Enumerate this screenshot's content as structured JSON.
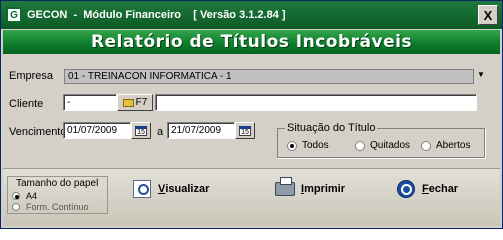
{
  "window": {
    "title": "GECON  -  Módulo Financeiro    [ Versão 3.1.2.84 ]",
    "close_glyph": "X"
  },
  "banner": {
    "title": "Relatório de Títulos Incobráveis"
  },
  "empresa": {
    "label": "Empresa",
    "value": "01 - TREINACON INFORMATICA - 1"
  },
  "cliente": {
    "label": "Cliente",
    "code_value": "-",
    "lookup_label": "F7",
    "name_value": ""
  },
  "vencimento": {
    "label": "Vencimento",
    "from": "01/07/2009",
    "separator": "a",
    "to": "21/07/2009",
    "calendar_glyph": "15"
  },
  "situacao": {
    "title": "Situação do Título",
    "options": [
      {
        "label": "Todos",
        "checked": true
      },
      {
        "label": "Quitados",
        "checked": false
      },
      {
        "label": "Abertos",
        "checked": false
      }
    ]
  },
  "tamanho_papel": {
    "title": "Tamanho do papel",
    "options": [
      {
        "label": "A4",
        "checked": true
      },
      {
        "label": "Form. Contínuo",
        "checked": false
      }
    ]
  },
  "actions": {
    "visualizar_first": "V",
    "visualizar_rest": "isualizar",
    "imprimir_first": "I",
    "imprimir_rest": "mprimir",
    "fechar_first": "F",
    "fechar_rest": "echar"
  }
}
